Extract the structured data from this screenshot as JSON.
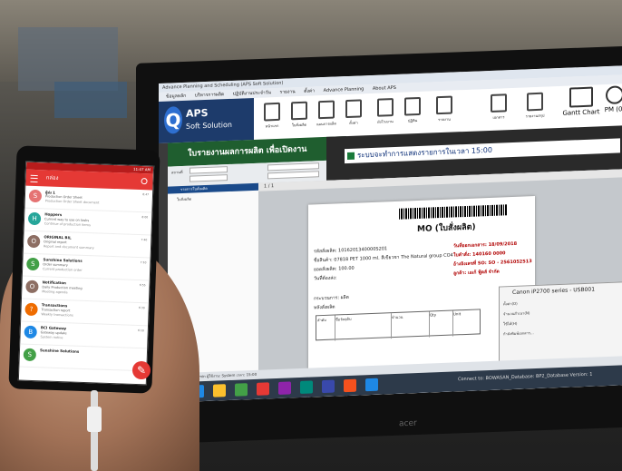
{
  "scene": {
    "description_tag": "photo"
  },
  "app": {
    "window_title": "Advance Planning and Scheduling (APS Soft Solution)",
    "menu": [
      "ข้อมูลหลัก",
      "บริหารการผลิต",
      "ปฏิบัติงานประจำวัน",
      "รายงาน",
      "ตั้งค่า",
      "Advance Planning",
      "About APS"
    ],
    "logo_line1": "APS",
    "logo_line2": "Soft Solution",
    "toolbar_buttons": [
      "หน้าแรก",
      "ใบสั่งผลิต",
      "แผนการผลิต",
      "ตั้งค่า",
      "ผังโรงงาน",
      "ปฏิทิน",
      "รายงาน",
      "เอกสาร",
      "รายงานสรุป"
    ],
    "gantt_label": "Gantt Chart",
    "pm_label": "PM (0)",
    "green_band": "ใบรายงานผลการผลิต เพื่อเปิดงาน",
    "banner": "ระบบจะทำการแสดงรายการในเวลา 15:00",
    "side_header": "รายการใบสั่งผลิต",
    "side_row": "ใบสั่งผลิต",
    "doc_toolbar": "1 / 1",
    "mo_title": "MO (ใบสั่งผลิต)",
    "fields": [
      "รหัสสั่งผลิต: 1016201340000S201",
      "ชื่อสินค้า: 07818 PET 1000 ml. สีเขียวชา The Natural group CO4",
      "ยอดสั่งผลิต: 100.00",
      "วันที่ต้องส่ง:",
      "วันที่ออกเอกสาร: 18/09/2018",
      "ใบคำสั่ง: 140160 0000",
      "อ้างอิงเลขที่ SO: SO - 2561052513",
      "ลูกค้า: เอเก้ ฟู้ดส์ จำกัด",
      "กระบวนการ: ผลิต",
      "หลังสั่งผลิต"
    ],
    "table_headers": [
      "ลำดับ",
      "ชื่อวัตถุดิบ",
      "จำนวน",
      "Qty",
      "Unit"
    ],
    "print_dialog_title": "Canon iP2700 series - USB001",
    "print_rows": [
      "ตั้งค่า(O)",
      "จำนวนสำเนา(N)",
      "ใช้ได้(H)",
      "กำลังพิมพ์เอกสาร..."
    ],
    "status_bar": "Ready By: admin   ผู้ใช้งาน: System   เวลา: 15:00",
    "connect_text": "Connect to: BOWASAN_Database: BP2_Database Version: 1",
    "monitor_brand": "acer"
  },
  "phone": {
    "status": "11:47 AM",
    "title": "กล่อง",
    "mails": [
      {
        "initial": "S",
        "color": "#e57373",
        "from": "ผู้ส่ง 1",
        "subject": "Production Order Sheet",
        "snippet": "Production Order Sheet document",
        "time": "8:47"
      },
      {
        "initial": "H",
        "color": "#26a69a",
        "from": "Hoppers",
        "subject": "Current way to use on tasks",
        "snippet": "Continue of production items",
        "time": "8:00"
      },
      {
        "initial": "O",
        "color": "#8d6e63",
        "from": "ORIGINAL BIL",
        "subject": "Original report",
        "snippet": "Report and document summary",
        "time": "7:40"
      },
      {
        "initial": "S",
        "color": "#43a047",
        "from": "Sunshine Solutions",
        "subject": "Order summary",
        "snippet": "Current production order",
        "time": "7:10"
      },
      {
        "initial": "O",
        "color": "#8d6e63",
        "from": "Notification",
        "subject": "Daily Production meeting",
        "snippet": "Meeting agenda",
        "time": "6:55"
      },
      {
        "initial": "?",
        "color": "#ef6c00",
        "from": "Transactions",
        "subject": "Transaction report",
        "snippet": "Weekly transactions",
        "time": "6:30"
      },
      {
        "initial": "B",
        "color": "#1e88e5",
        "from": "BCI Gateway",
        "subject": "Gateway update",
        "snippet": "System notice",
        "time": "6:10"
      },
      {
        "initial": "S",
        "color": "#43a047",
        "from": "Sunshine Solutions",
        "subject": "",
        "snippet": "",
        "time": ""
      }
    ],
    "fab": "✎"
  }
}
